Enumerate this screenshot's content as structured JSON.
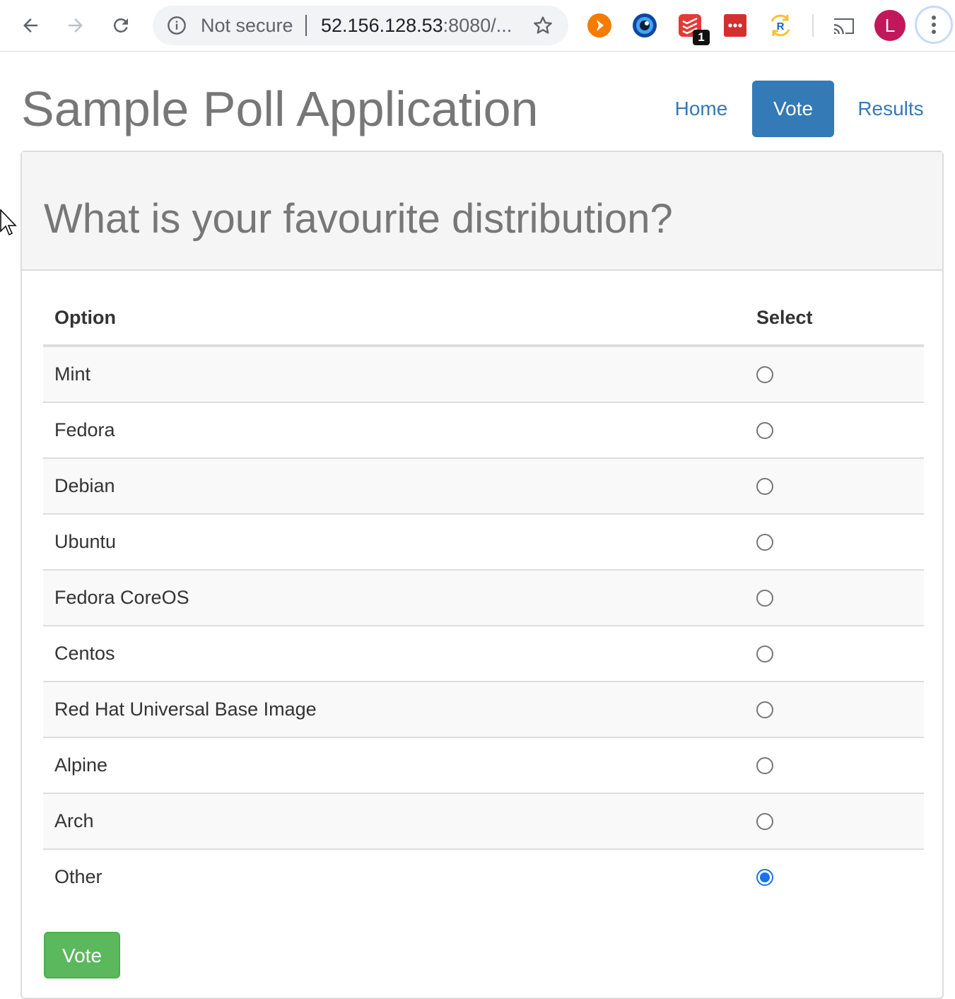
{
  "browser": {
    "security_label": "Not secure",
    "url_host": "52.156.128.53",
    "url_rest": ":8080/...",
    "extensions": [
      {
        "icon": "play-extension-icon",
        "color": "#f57c00"
      },
      {
        "icon": "eye-extension-icon",
        "color": "#1565c0"
      },
      {
        "icon": "todoist-extension-icon",
        "color": "#e53935",
        "badge": "1"
      },
      {
        "icon": "dots-extension-icon",
        "color": "#d32f2f"
      },
      {
        "icon": "refresh-r-extension-icon",
        "color": "#fbc02d"
      }
    ],
    "profile_initial": "L",
    "colors": {
      "profile": "#c2185b",
      "toolbar_bg": "#ffffff",
      "omnibox_bg": "#f1f3f4"
    }
  },
  "page": {
    "title": "Sample Poll Application",
    "nav": [
      {
        "label": "Home",
        "active": false
      },
      {
        "label": "Vote",
        "active": true
      },
      {
        "label": "Results",
        "active": false
      }
    ]
  },
  "poll": {
    "question": "What is your favourite distribution?",
    "columns": {
      "option": "Option",
      "select": "Select"
    },
    "options": [
      {
        "label": "Mint",
        "selected": false
      },
      {
        "label": "Fedora",
        "selected": false
      },
      {
        "label": "Debian",
        "selected": false
      },
      {
        "label": "Ubuntu",
        "selected": false
      },
      {
        "label": "Fedora CoreOS",
        "selected": false
      },
      {
        "label": "Centos",
        "selected": false
      },
      {
        "label": "Red Hat Universal Base Image",
        "selected": false
      },
      {
        "label": "Alpine",
        "selected": false
      },
      {
        "label": "Arch",
        "selected": false
      },
      {
        "label": "Other",
        "selected": true
      }
    ],
    "submit_label": "Vote"
  },
  "colors": {
    "primary": "#337ab7",
    "success": "#5cb85c",
    "heading_text": "#777777",
    "radio_checked": "#1a73e8"
  }
}
